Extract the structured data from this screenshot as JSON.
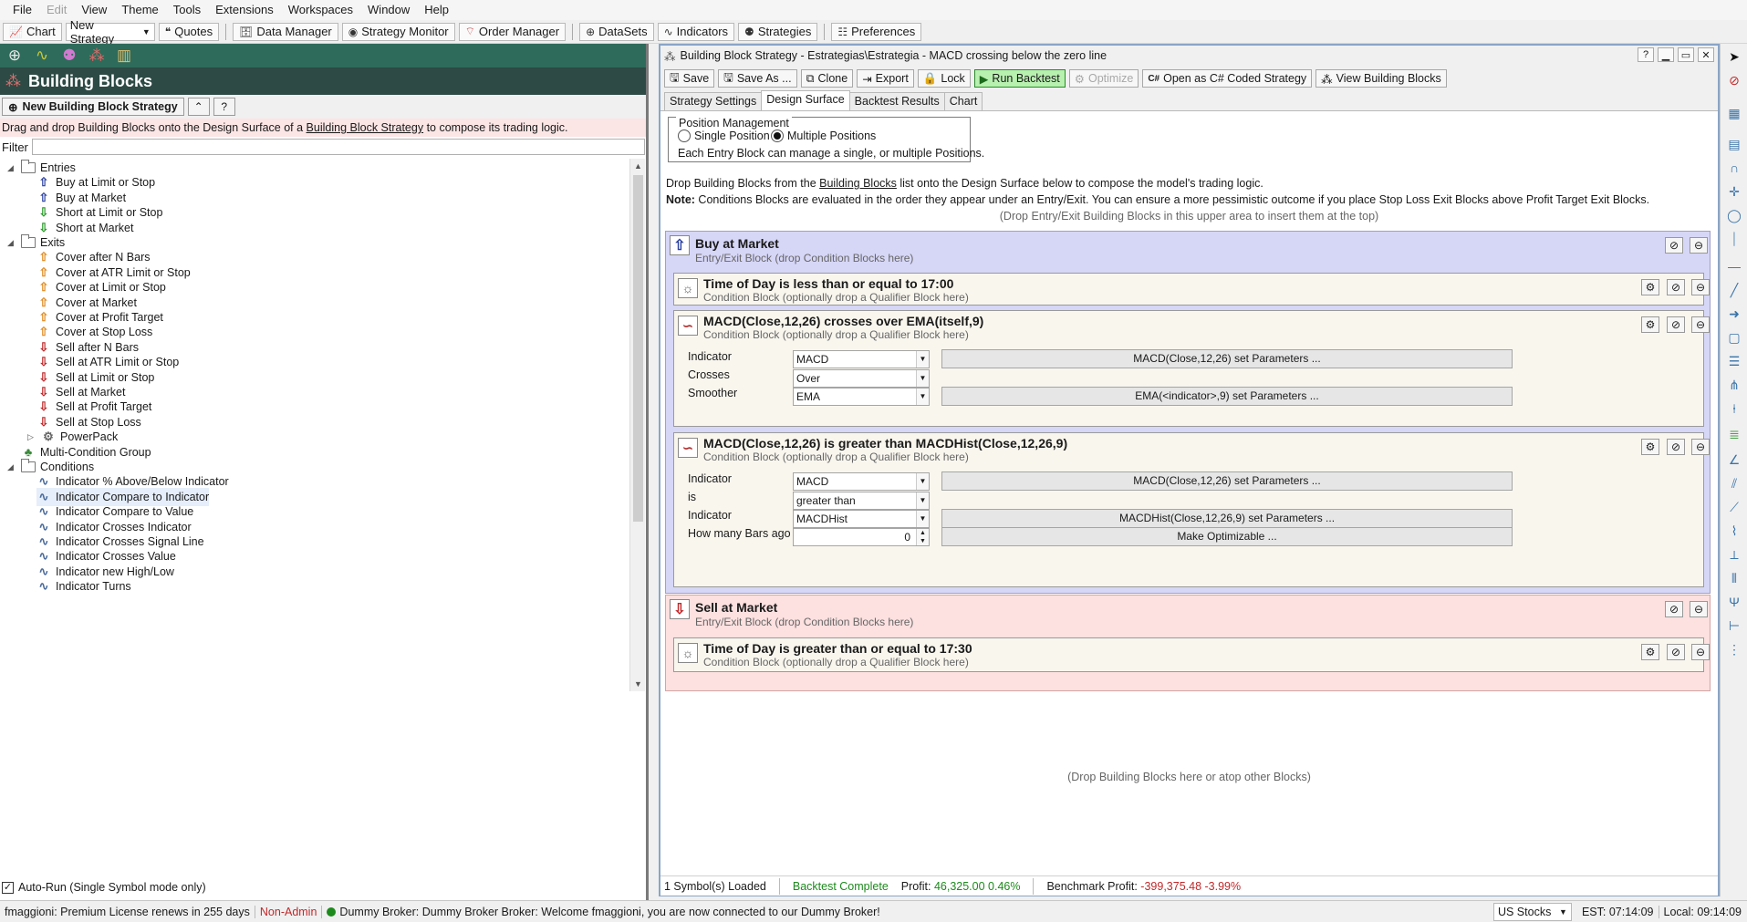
{
  "menu": [
    "File",
    "Edit",
    "View",
    "Theme",
    "Tools",
    "Extensions",
    "Workspaces",
    "Window",
    "Help"
  ],
  "menu_disabled": "Edit",
  "toolbar": {
    "chart": "Chart",
    "new_strategy": "New Strategy",
    "quotes": "Quotes",
    "data_manager": "Data Manager",
    "strategy_monitor": "Strategy Monitor",
    "order_manager": "Order Manager",
    "datasets": "DataSets",
    "indicators": "Indicators",
    "strategies": "Strategies",
    "preferences": "Preferences"
  },
  "left": {
    "title": "Building Blocks",
    "new_button": "New Building Block Strategy",
    "help_button": "?",
    "hint_prefix": "Drag and drop Building Blocks onto the Design Surface of a ",
    "hint_link": "Building Block Strategy",
    "hint_suffix": " to compose its trading logic.",
    "filter_label": "Filter",
    "autorun_label": "Auto-Run (Single Symbol mode only)"
  },
  "tree": {
    "entries": "Entries",
    "entry_items": [
      "Buy at Limit or Stop",
      "Buy at Market",
      "Short at Limit or Stop",
      "Short at Market"
    ],
    "exits": "Exits",
    "exit_items": [
      "Cover after N Bars",
      "Cover at ATR Limit or Stop",
      "Cover at Limit or Stop",
      "Cover at Market",
      "Cover at Profit Target",
      "Cover at Stop Loss",
      "Sell after N Bars",
      "Sell at ATR Limit or Stop",
      "Sell at Limit or Stop",
      "Sell at Market",
      "Sell at Profit Target",
      "Sell at Stop Loss"
    ],
    "powerpack": "PowerPack",
    "multi_condition": "Multi-Condition Group",
    "conditions": "Conditions",
    "condition_items": [
      "Indicator % Above/Below Indicator",
      "Indicator Compare to Indicator",
      "Indicator Compare to Value",
      "Indicator Crosses Indicator",
      "Indicator Crosses Signal Line",
      "Indicator Crosses Value",
      "Indicator new High/Low",
      "Indicator Turns"
    ]
  },
  "window": {
    "title": "Building Block Strategy - Estrategias\\Estrategia - MACD crossing below the zero line",
    "help": "?",
    "buttons": {
      "save": "Save",
      "save_as": "Save As ...",
      "clone": "Clone",
      "export": "Export",
      "lock": "Lock",
      "run_backtest": "Run Backtest",
      "optimize": "Optimize",
      "open_csharp": "Open as C# Coded Strategy",
      "view_blocks": "View Building Blocks"
    },
    "tabs": [
      "Strategy Settings",
      "Design Surface",
      "Backtest Results",
      "Chart"
    ],
    "active_tab": "Design Surface"
  },
  "design": {
    "pos_mgmt_title": "Position Management",
    "single_position": "Single Position",
    "multiple_positions": "Multiple Positions",
    "pos_note": "Each Entry Block can manage a single, or multiple Positions.",
    "drop_prefix": "Drop Building Blocks from the ",
    "drop_link": "Building Blocks",
    "drop_suffix": " list onto the Design Surface below to compose the model's trading logic.",
    "note_label": "Note:",
    "note_text": " Conditions Blocks are evaluated in the order they appear under an Entry/Exit. You can ensure a more pessimistic outcome if you place Stop Loss Exit Blocks above Profit Target Exit Blocks.",
    "top_hint": "(Drop Entry/Exit Building Blocks in this upper area to insert them at the top)",
    "bottom_hint": "(Drop Building Blocks here or atop other Blocks)"
  },
  "entry_block": {
    "title": "Buy at Market",
    "sub": "Entry/Exit Block (drop Condition Blocks here)",
    "cond1": {
      "title": "Time of Day is less than or equal to 17:00",
      "sub": "Condition Block (optionally drop a Qualifier Block here)"
    },
    "cond2": {
      "title": "MACD(Close,12,26) crosses over EMA(itself,9)",
      "sub": "Condition Block (optionally drop a Qualifier Block here)",
      "labels": [
        "Indicator",
        "Crosses",
        "Smoother"
      ],
      "values": [
        "MACD",
        "Over",
        "EMA"
      ],
      "params1": "MACD(Close,12,26) set Parameters ...",
      "params2": "EMA(<indicator>,9) set Parameters ..."
    },
    "cond3": {
      "title": "MACD(Close,12,26) is greater than MACDHist(Close,12,26,9)",
      "sub": "Condition Block (optionally drop a Qualifier Block here)",
      "labels": [
        "Indicator",
        "is",
        "Indicator",
        "How many Bars ago"
      ],
      "values": [
        "MACD",
        "greater than",
        "MACDHist",
        "0"
      ],
      "params1": "MACD(Close,12,26) set Parameters ...",
      "params2": "MACDHist(Close,12,26,9) set Parameters ...",
      "optimizable": "Make Optimizable ..."
    }
  },
  "exit_block": {
    "title": "Sell at Market",
    "sub": "Entry/Exit Block (drop Condition Blocks here)",
    "cond1": {
      "title": "Time of Day is greater than or equal to 17:30",
      "sub": "Condition Block (optionally drop a Qualifier Block here)"
    }
  },
  "window_status": {
    "symbols": "1 Symbol(s) Loaded",
    "backtest": "Backtest Complete",
    "profit_label": "Profit:",
    "profit_value": "46,325.00 0.46%",
    "bench_label": "Benchmark Profit:",
    "bench_value": "-399,375.48 -3.99%"
  },
  "statusbar": {
    "license": "fmaggioni: Premium License renews in 255 days",
    "admin": "Non-Admin",
    "broker": "Dummy Broker: Dummy Broker Broker: Welcome fmaggioni, you are now connected to our Dummy Broker!",
    "market": "US Stocks",
    "est": "EST: 07:14:09",
    "local": "Local: 09:14:09"
  },
  "colors": {
    "profit_green": "#1c8a1c",
    "loss_red": "#c0282a",
    "entry_bg": "#d6d6f7",
    "exit_bg": "#fde0e0",
    "left_header": "#2d4a44"
  }
}
